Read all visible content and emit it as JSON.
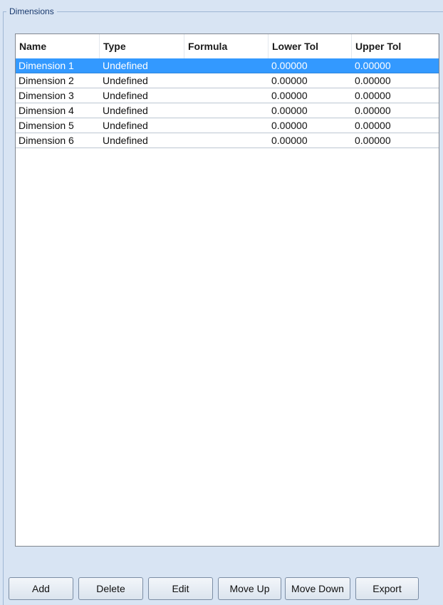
{
  "group": {
    "title": "Dimensions"
  },
  "table": {
    "columns": [
      "Name",
      "Type",
      "Formula",
      "Lower Tol",
      "Upper Tol"
    ],
    "rows": [
      {
        "name": "Dimension 1",
        "type": "Undefined",
        "formula": "",
        "lower": "0.00000",
        "upper": "0.00000",
        "selected": true
      },
      {
        "name": "Dimension 2",
        "type": "Undefined",
        "formula": "",
        "lower": "0.00000",
        "upper": "0.00000",
        "selected": false
      },
      {
        "name": "Dimension 3",
        "type": "Undefined",
        "formula": "",
        "lower": "0.00000",
        "upper": "0.00000",
        "selected": false
      },
      {
        "name": "Dimension 4",
        "type": "Undefined",
        "formula": "",
        "lower": "0.00000",
        "upper": "0.00000",
        "selected": false
      },
      {
        "name": "Dimension 5",
        "type": "Undefined",
        "formula": "",
        "lower": "0.00000",
        "upper": "0.00000",
        "selected": false
      },
      {
        "name": "Dimension 6",
        "type": "Undefined",
        "formula": "",
        "lower": "0.00000",
        "upper": "0.00000",
        "selected": false
      }
    ]
  },
  "buttons": {
    "add": "Add",
    "delete": "Delete",
    "edit": "Edit",
    "move_up": "Move Up",
    "move_down": "Move Down",
    "export": "Export"
  },
  "colors": {
    "selection": "#3399ff",
    "panel_background": "#d8e4f3"
  }
}
